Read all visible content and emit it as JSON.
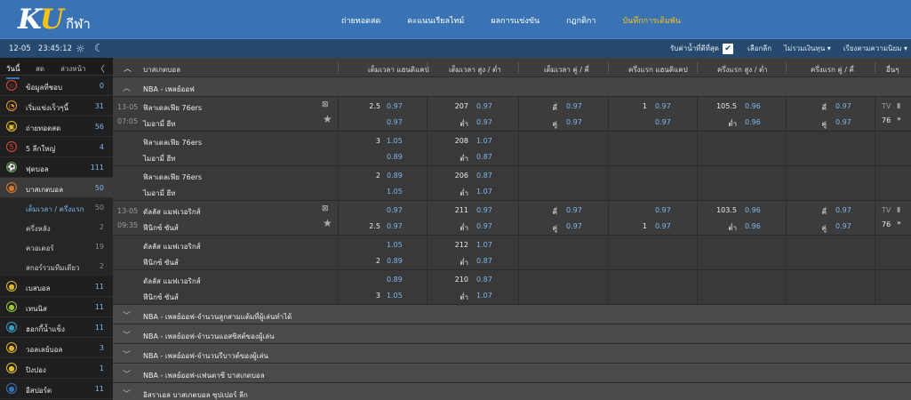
{
  "header": {
    "logo_k": "K",
    "logo_u": "U",
    "logo_sub": "กีฬา",
    "nav": [
      "ถ่ายทอดสด",
      "คะแนนเรียลไทม์",
      "ผลการแข่งขัน",
      "กฎกติกา",
      "บันทึกการเดิมพัน"
    ],
    "nav_active": 4
  },
  "subbar": {
    "date": "12-05",
    "time": "23:45:12",
    "best_odds_label": "รับค่าน้ำที่ดีที่สุด",
    "best_odds_check": "✔",
    "select_label": "เลือกลีก",
    "odds_type": "ไม่รวมเงินทุน ▾",
    "sort": "เรียงตามความนิยม ▾"
  },
  "sidebar": {
    "tabs": [
      "วันนี้",
      "สด",
      "ล่วงหน้า"
    ],
    "collapse": "〈",
    "items": [
      {
        "label": "ข้อมูลที่ชอบ",
        "count": "0",
        "icon": "☆",
        "color": "#e0493b"
      },
      {
        "label": "เริ่มแข่งเร็วๆนี้",
        "count": "31",
        "icon": "◔",
        "color": "#e69a2b"
      },
      {
        "label": "ถ่ายทอดสด",
        "count": "56",
        "icon": "▣",
        "color": "#e0c22b"
      },
      {
        "label": "5 ลีกใหญ่",
        "count": "4",
        "icon": "5",
        "color": "#e0493b"
      },
      {
        "label": "ฟุตบอล",
        "count": "111",
        "icon": "⚽",
        "color": "#5aa144"
      },
      {
        "label": "บาสเกตบอล",
        "count": "50",
        "icon": "●",
        "color": "#d9782b"
      }
    ],
    "subitems": [
      {
        "label": "เต็มเวลา / ครึ่งแรก",
        "count": "50"
      },
      {
        "label": "ครึ่งหลัง",
        "count": "2"
      },
      {
        "label": "ควอเตอร์",
        "count": "19"
      },
      {
        "label": "สกอร์รวมทีมเดียว",
        "count": "2"
      }
    ],
    "items2": [
      {
        "label": "เบสบอล",
        "count": "11",
        "icon": "●",
        "color": "#d9b82b"
      },
      {
        "label": "เทนนิส",
        "count": "11",
        "icon": "●",
        "color": "#9ac53a"
      },
      {
        "label": "ฮอกกี้น้ำแข็ง",
        "count": "11",
        "icon": "●",
        "color": "#3aa0c5"
      },
      {
        "label": "วอลเลย์บอล",
        "count": "3",
        "icon": "●",
        "color": "#e0b22b"
      },
      {
        "label": "ปิงปอง",
        "count": "1",
        "icon": "●",
        "color": "#e0c22b"
      },
      {
        "label": "อีสปอร์ต",
        "count": "11",
        "icon": "●",
        "color": "#3a73b3"
      }
    ]
  },
  "main": {
    "sport": "บาสเกตบอล",
    "columns": [
      "เต็มเวลา แฮนดิแคป",
      "เต็มเวลา สูง / ต่ำ",
      "เต็มเวลา คู่ / คี่",
      "ครึ่งแรก แฮนดิแคป",
      "ครึ่งแรก สูง / ต่ำ",
      "ครึ่งแรก คู่ / คี่",
      "อื่นๆ"
    ],
    "league_open": "NBA - เพลย์ออฟ",
    "matches": [
      {
        "date": "13-05",
        "time": "07:05",
        "extra_count": "76",
        "lines": [
          {
            "home": "ฟิลาเดลเฟีย 76ers",
            "away": "ไมอามี่ ฮีท",
            "hc_line": "2.5",
            "hc_home": "0.97",
            "hc_away": "0.97",
            "ou_line": "207",
            "ou_over": "0.97",
            "ou_under_label": "ต่ำ",
            "ou_under": "0.97",
            "oe_odd_label": "คี่",
            "oe_odd": "0.97",
            "oe_even_label": "คู่",
            "oe_even": "0.97",
            "h1hc_line": "1",
            "h1hc_home": "0.97",
            "h1hc_away": "0.97",
            "h1ou_line": "105.5",
            "h1ou_over": "0.96",
            "h1ou_under_label": "ต่ำ",
            "h1ou_under": "0.96",
            "h1oe_odd_label": "คี่",
            "h1oe_odd": "0.97",
            "h1oe_even_label": "คู่",
            "h1oe_even": "0.97"
          },
          {
            "home": "ฟิลาเดลเฟีย 76ers",
            "away": "ไมอามี่ ฮีท",
            "hc_line": "3",
            "hc_home": "1.05",
            "hc_away": "0.89",
            "ou_line": "208",
            "ou_over": "1.07",
            "ou_under_label": "ต่ำ",
            "ou_under": "0.87"
          },
          {
            "home": "ฟิลาเดลเฟีย 76ers",
            "away": "ไมอามี่ ฮีท",
            "hc_line": "2",
            "hc_home": "0.89",
            "hc_away": "1.05",
            "ou_line": "206",
            "ou_over": "0.87",
            "ou_under_label": "ต่ำ",
            "ou_under": "1.07"
          }
        ]
      },
      {
        "date": "13-05",
        "time": "09:35",
        "extra_count": "76",
        "lines": [
          {
            "home": "ดัลลัส แมฟเวอริกส์",
            "away": "ฟีนิกซ์ ซันส์",
            "hc_line": "2.5",
            "hc_home": "0.97",
            "hc_away": "0.97",
            "ou_line": "211",
            "ou_over": "0.97",
            "ou_under_label": "ต่ำ",
            "ou_under": "0.97",
            "oe_odd_label": "คี่",
            "oe_odd": "0.97",
            "oe_even_label": "คู่",
            "oe_even": "0.97",
            "h1hc_line": "1",
            "h1hc_home": "0.97",
            "h1hc_away": "0.97",
            "h1ou_line": "103.5",
            "h1ou_over": "0.96",
            "h1ou_under_label": "ต่ำ",
            "h1ou_under": "0.96",
            "h1oe_odd_label": "คี่",
            "h1oe_odd": "0.97",
            "h1oe_even_label": "คู่",
            "h1oe_even": "0.97"
          },
          {
            "home": "ดัลลัส แมฟเวอริกส์",
            "away": "ฟีนิกซ์ ซันส์",
            "hc_line": "2",
            "hc_home": "1.05",
            "hc_away": "0.89",
            "ou_line": "212",
            "ou_over": "1.07",
            "ou_under_label": "ต่ำ",
            "ou_under": "0.87"
          },
          {
            "home": "ดัลลัส แมฟเวอริกส์",
            "away": "ฟีนิกซ์ ซันส์",
            "hc_line": "3",
            "hc_home": "0.89",
            "hc_away": "1.05",
            "ou_line": "210",
            "ou_over": "0.87",
            "ou_under_label": "ต่ำ",
            "ou_under": "1.07"
          }
        ]
      }
    ],
    "collapsed_leagues": [
      "NBA - เพลย์ออฟ-จำนวนลูกสามแต้มที่ผู้เล่นทำได้",
      "NBA - เพลย์ออฟ-จำนวนแอสซิสต์ของผู้เล่น",
      "NBA - เพลย์ออฟ-จำนวนรีบาวด์ของผู้เล่น",
      "NBA - เพลย์ออฟ-แฟนตาซี บาสเกตบอล",
      "อิสราเอล บาสเกตบอล ซุปเปอร์ ลีก"
    ],
    "tv_label": "TV",
    "more_icon": "»"
  }
}
